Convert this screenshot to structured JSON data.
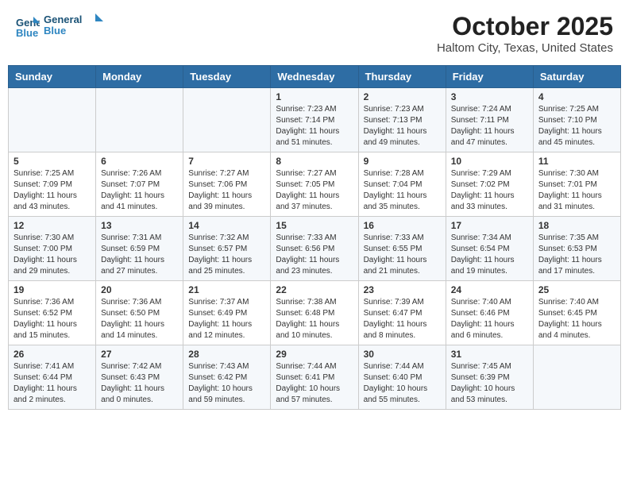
{
  "logo": {
    "line1": "General",
    "line2": "Blue"
  },
  "title": "October 2025",
  "location": "Haltom City, Texas, United States",
  "weekdays": [
    "Sunday",
    "Monday",
    "Tuesday",
    "Wednesday",
    "Thursday",
    "Friday",
    "Saturday"
  ],
  "weeks": [
    [
      {
        "day": "",
        "info": ""
      },
      {
        "day": "",
        "info": ""
      },
      {
        "day": "",
        "info": ""
      },
      {
        "day": "1",
        "info": "Sunrise: 7:23 AM\nSunset: 7:14 PM\nDaylight: 11 hours\nand 51 minutes."
      },
      {
        "day": "2",
        "info": "Sunrise: 7:23 AM\nSunset: 7:13 PM\nDaylight: 11 hours\nand 49 minutes."
      },
      {
        "day": "3",
        "info": "Sunrise: 7:24 AM\nSunset: 7:11 PM\nDaylight: 11 hours\nand 47 minutes."
      },
      {
        "day": "4",
        "info": "Sunrise: 7:25 AM\nSunset: 7:10 PM\nDaylight: 11 hours\nand 45 minutes."
      }
    ],
    [
      {
        "day": "5",
        "info": "Sunrise: 7:25 AM\nSunset: 7:09 PM\nDaylight: 11 hours\nand 43 minutes."
      },
      {
        "day": "6",
        "info": "Sunrise: 7:26 AM\nSunset: 7:07 PM\nDaylight: 11 hours\nand 41 minutes."
      },
      {
        "day": "7",
        "info": "Sunrise: 7:27 AM\nSunset: 7:06 PM\nDaylight: 11 hours\nand 39 minutes."
      },
      {
        "day": "8",
        "info": "Sunrise: 7:27 AM\nSunset: 7:05 PM\nDaylight: 11 hours\nand 37 minutes."
      },
      {
        "day": "9",
        "info": "Sunrise: 7:28 AM\nSunset: 7:04 PM\nDaylight: 11 hours\nand 35 minutes."
      },
      {
        "day": "10",
        "info": "Sunrise: 7:29 AM\nSunset: 7:02 PM\nDaylight: 11 hours\nand 33 minutes."
      },
      {
        "day": "11",
        "info": "Sunrise: 7:30 AM\nSunset: 7:01 PM\nDaylight: 11 hours\nand 31 minutes."
      }
    ],
    [
      {
        "day": "12",
        "info": "Sunrise: 7:30 AM\nSunset: 7:00 PM\nDaylight: 11 hours\nand 29 minutes."
      },
      {
        "day": "13",
        "info": "Sunrise: 7:31 AM\nSunset: 6:59 PM\nDaylight: 11 hours\nand 27 minutes."
      },
      {
        "day": "14",
        "info": "Sunrise: 7:32 AM\nSunset: 6:57 PM\nDaylight: 11 hours\nand 25 minutes."
      },
      {
        "day": "15",
        "info": "Sunrise: 7:33 AM\nSunset: 6:56 PM\nDaylight: 11 hours\nand 23 minutes."
      },
      {
        "day": "16",
        "info": "Sunrise: 7:33 AM\nSunset: 6:55 PM\nDaylight: 11 hours\nand 21 minutes."
      },
      {
        "day": "17",
        "info": "Sunrise: 7:34 AM\nSunset: 6:54 PM\nDaylight: 11 hours\nand 19 minutes."
      },
      {
        "day": "18",
        "info": "Sunrise: 7:35 AM\nSunset: 6:53 PM\nDaylight: 11 hours\nand 17 minutes."
      }
    ],
    [
      {
        "day": "19",
        "info": "Sunrise: 7:36 AM\nSunset: 6:52 PM\nDaylight: 11 hours\nand 15 minutes."
      },
      {
        "day": "20",
        "info": "Sunrise: 7:36 AM\nSunset: 6:50 PM\nDaylight: 11 hours\nand 14 minutes."
      },
      {
        "day": "21",
        "info": "Sunrise: 7:37 AM\nSunset: 6:49 PM\nDaylight: 11 hours\nand 12 minutes."
      },
      {
        "day": "22",
        "info": "Sunrise: 7:38 AM\nSunset: 6:48 PM\nDaylight: 11 hours\nand 10 minutes."
      },
      {
        "day": "23",
        "info": "Sunrise: 7:39 AM\nSunset: 6:47 PM\nDaylight: 11 hours\nand 8 minutes."
      },
      {
        "day": "24",
        "info": "Sunrise: 7:40 AM\nSunset: 6:46 PM\nDaylight: 11 hours\nand 6 minutes."
      },
      {
        "day": "25",
        "info": "Sunrise: 7:40 AM\nSunset: 6:45 PM\nDaylight: 11 hours\nand 4 minutes."
      }
    ],
    [
      {
        "day": "26",
        "info": "Sunrise: 7:41 AM\nSunset: 6:44 PM\nDaylight: 11 hours\nand 2 minutes."
      },
      {
        "day": "27",
        "info": "Sunrise: 7:42 AM\nSunset: 6:43 PM\nDaylight: 11 hours\nand 0 minutes."
      },
      {
        "day": "28",
        "info": "Sunrise: 7:43 AM\nSunset: 6:42 PM\nDaylight: 10 hours\nand 59 minutes."
      },
      {
        "day": "29",
        "info": "Sunrise: 7:44 AM\nSunset: 6:41 PM\nDaylight: 10 hours\nand 57 minutes."
      },
      {
        "day": "30",
        "info": "Sunrise: 7:44 AM\nSunset: 6:40 PM\nDaylight: 10 hours\nand 55 minutes."
      },
      {
        "day": "31",
        "info": "Sunrise: 7:45 AM\nSunset: 6:39 PM\nDaylight: 10 hours\nand 53 minutes."
      },
      {
        "day": "",
        "info": ""
      }
    ]
  ]
}
